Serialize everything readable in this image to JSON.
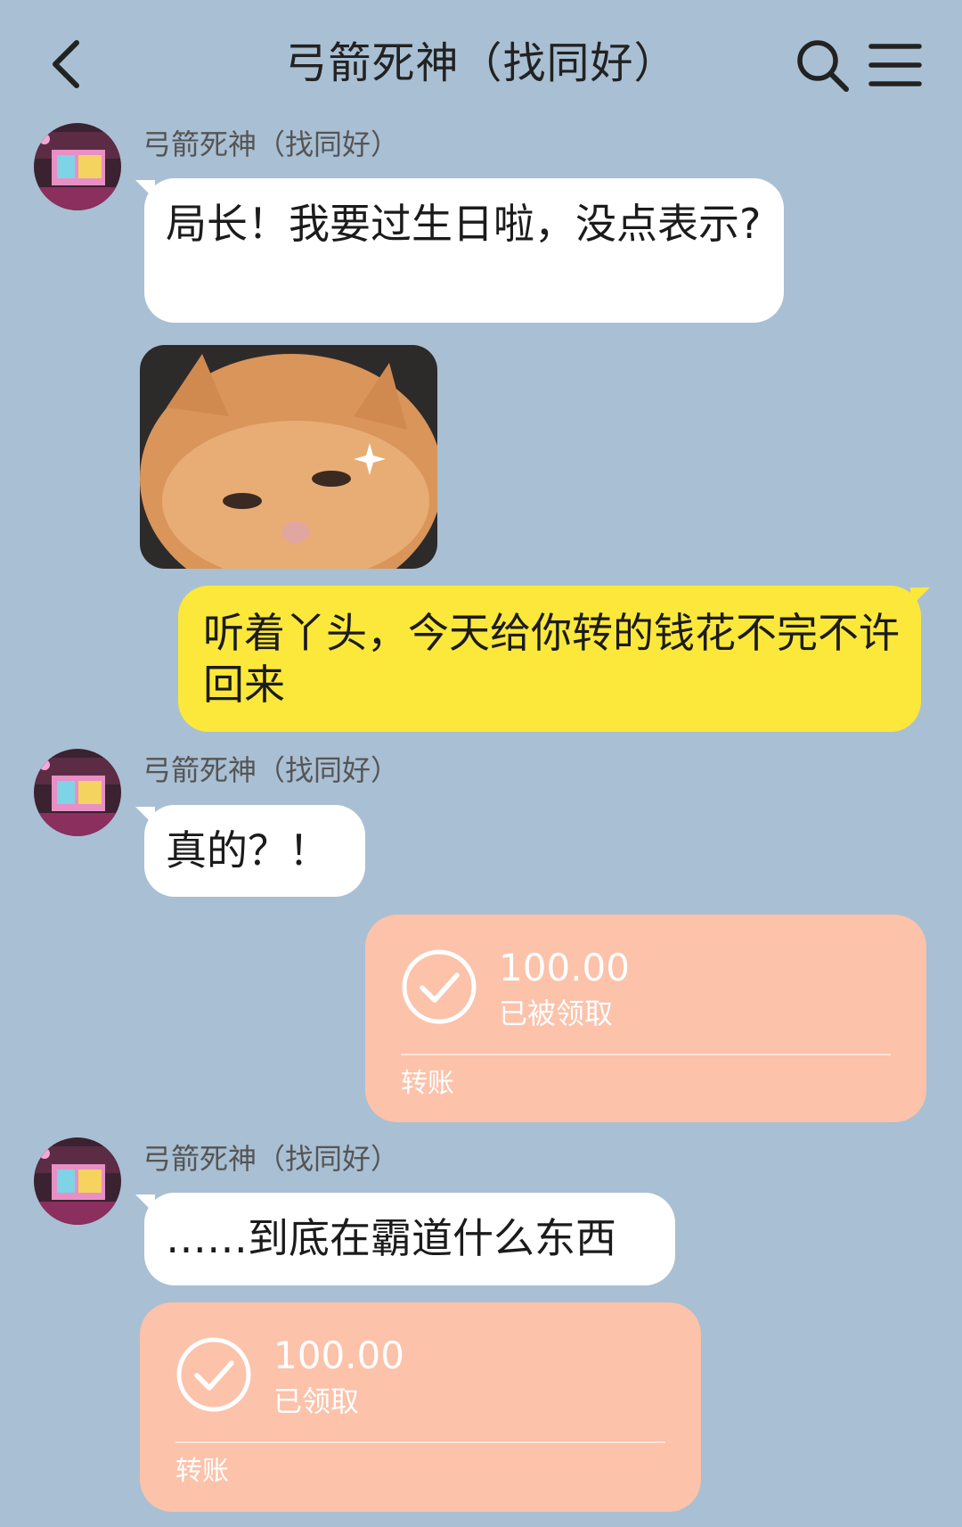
{
  "header": {
    "title": "弓箭死神（找同好）",
    "back_icon": "chevron-left-icon",
    "search_icon": "search-icon",
    "menu_icon": "menu-icon"
  },
  "messages": [
    {
      "sender": "弓箭死神（找同好）",
      "text": "局长！我要过生日啦，没点表示?"
    },
    {
      "sticker": "kitten-sticker"
    },
    {
      "text": "听着丫头，今天给你转的钱花不完不许回来"
    },
    {
      "sender": "弓箭死神（找同好）",
      "text": "真的？！"
    },
    {
      "transfer": {
        "amount": "100.00",
        "status": "已被领取",
        "label": "转账"
      }
    },
    {
      "sender": "弓箭死神（找同好）",
      "text": "……到底在霸道什么东西"
    },
    {
      "transfer": {
        "amount": "100.00",
        "status": "已领取",
        "label": "转账"
      }
    }
  ],
  "colors": {
    "background": "#A9BFD3",
    "incoming_bubble": "#FFFFFF",
    "outgoing_bubble": "#FBE83A",
    "transfer_card": "#FCC2AA"
  }
}
